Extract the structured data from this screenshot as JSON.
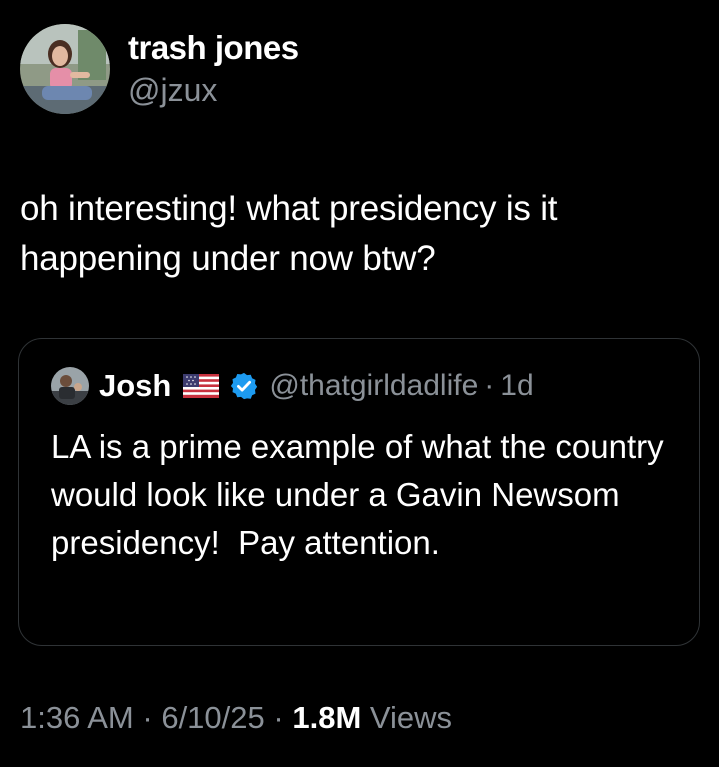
{
  "author": {
    "display_name": "trash jones",
    "handle": "@jzux",
    "avatar_icon": "profile-photo"
  },
  "tweet": {
    "text": "oh interesting! what presidency is it happening under now btw?"
  },
  "quoted_tweet": {
    "display_name": "Josh",
    "flag_icon": "us-flag-icon",
    "badge_icon": "verified-badge-icon",
    "handle": "@thatgirldadlife",
    "separator": "·",
    "time": "1d",
    "text": "LA is a prime example of what the country would look like under a Gavin Newsom presidency!  Pay attention."
  },
  "meta": {
    "time": "1:36 AM",
    "sep1": "·",
    "date": "6/10/25",
    "sep2": "·",
    "views_count": "1.8M",
    "views_label": "Views"
  },
  "colors": {
    "background": "#000000",
    "text_primary": "#ffffff",
    "text_secondary": "#8b9198",
    "verified_blue": "#1d9bf0",
    "card_border": "#2f3336"
  }
}
